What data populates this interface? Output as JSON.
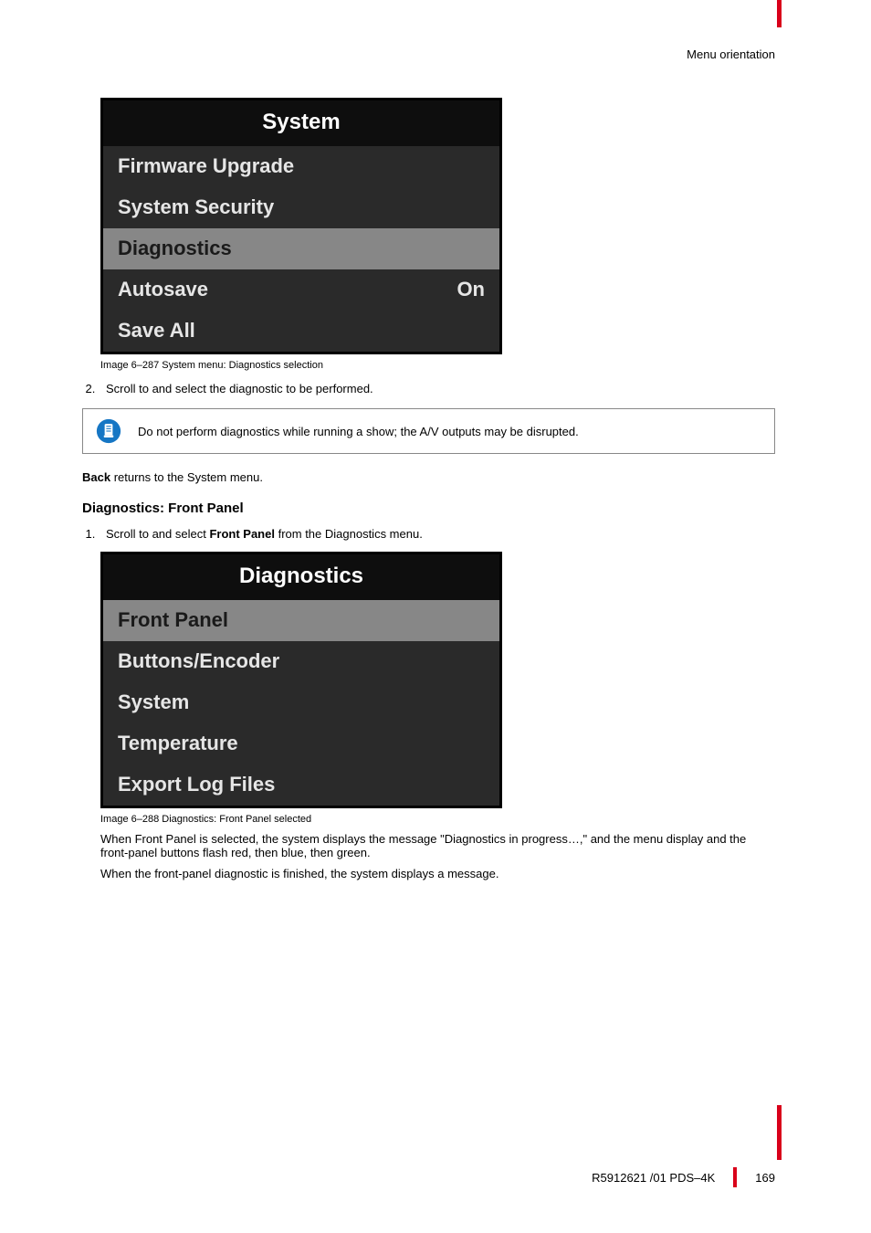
{
  "header": {
    "section": "Menu orientation"
  },
  "menu1": {
    "title": "System",
    "rows": [
      {
        "label": "Firmware Upgrade",
        "value": "",
        "selected": false
      },
      {
        "label": "System Security",
        "value": "",
        "selected": false
      },
      {
        "label": "Diagnostics",
        "value": "",
        "selected": true
      },
      {
        "label": "Autosave",
        "value": "On",
        "selected": false
      },
      {
        "label": "Save All",
        "value": "",
        "selected": false
      }
    ],
    "caption": "Image 6–287  System menu: Diagnostics selection"
  },
  "step2": "Scroll to and select the diagnostic to be performed.",
  "note": "Do not perform diagnostics while running a show; the A/V outputs may be disrupted.",
  "back_line_prefix": "Back",
  "back_line_rest": " returns to the System menu.",
  "diag_heading": "Diagnostics: Front Panel",
  "step1_prefix": "Scroll to and select ",
  "step1_bold": "Front Panel",
  "step1_suffix": " from the Diagnostics menu.",
  "menu2": {
    "title": "Diagnostics",
    "rows": [
      {
        "label": "Front Panel",
        "selected": true
      },
      {
        "label": "Buttons/Encoder",
        "selected": false
      },
      {
        "label": "System",
        "selected": false
      },
      {
        "label": "Temperature",
        "selected": false
      },
      {
        "label": "Export Log Files",
        "selected": false
      }
    ],
    "caption": "Image 6–288  Diagnostics: Front Panel selected"
  },
  "body_para1": "When Front Panel is selected, the system displays the message \"Diagnostics in progress…,\" and the menu display and the front-panel buttons flash red, then blue, then green.",
  "body_para2": "When the front-panel diagnostic is finished, the system displays a message.",
  "footer": {
    "doc": "R5912621 /01 PDS–4K",
    "page": "169"
  }
}
